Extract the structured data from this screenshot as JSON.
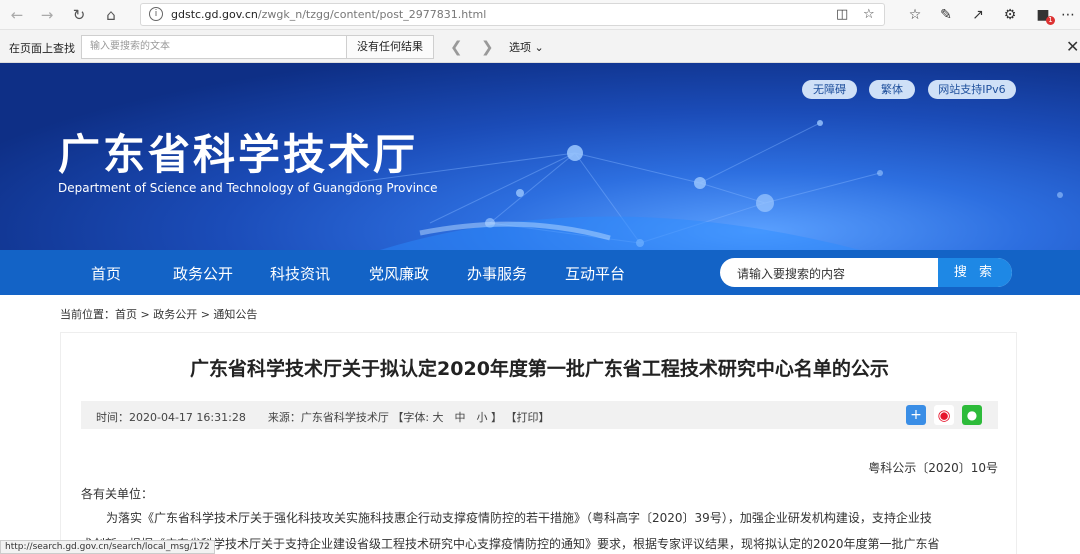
{
  "browser": {
    "url_host": "gdstc.gd.gov.cn",
    "url_path": "/zwgk_n/tzgg/content/post_2977831.html",
    "badge_count": "1"
  },
  "find_bar": {
    "label": "在页面上查找",
    "placeholder": "输入要搜索的文本",
    "result": "没有任何结果",
    "options": "选项"
  },
  "header": {
    "links": [
      "无障碍",
      "繁体",
      "网站支持IPv6"
    ],
    "title": "广东省科学技术厅",
    "subtitle": "Department of Science and Technology of Guangdong Province"
  },
  "nav": {
    "items": [
      "首页",
      "政务公开",
      "科技资讯",
      "党风廉政",
      "办事服务",
      "互动平台"
    ],
    "search_placeholder": "请输入要搜索的内容",
    "search_button": "搜 索"
  },
  "breadcrumb": "当前位置：首页 > 政务公开 > 通知公告",
  "article": {
    "title": "广东省科学技术厅关于拟认定2020年度第一批广东省工程技术研究中心名单的公示",
    "meta": "时间：2020-04-17 16:31:28　　来源：广东省科学技术厅 【字体: 大　中　小 】 【打印】",
    "doc_number": "粤科公示〔2020〕10号",
    "salutation": "各有关单位：",
    "paragraph_line1": "为落实《广东省科学技术厅关于强化科技攻关实施科技惠企行动支撑疫情防控的若干措施》（粤科高字〔2020〕39号），加强企业研发机构建设，支持企业技",
    "paragraph_line2": "术创新，根据《广东省科学技术厅关于支持企业建设省级工程技术研究中心支撑疫情防控的通知》要求，根据专家评议结果，现将拟认定的2020年度第一批广东省"
  },
  "status_url": "http://search.gd.gov.cn/search/local_msg/172"
}
